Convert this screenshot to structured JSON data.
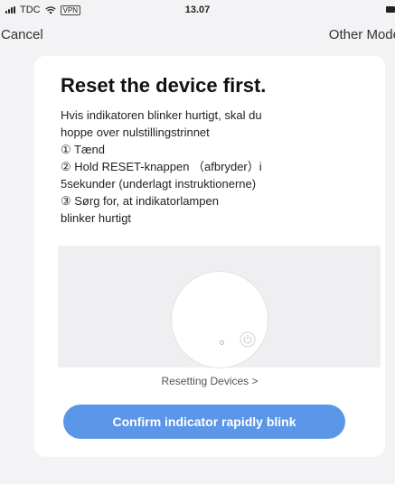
{
  "status_bar": {
    "carrier": "TDC",
    "vpn_badge": "VPN",
    "time": "13.07"
  },
  "nav": {
    "cancel_label": "Cancel",
    "other_mode_label": "Other Mode"
  },
  "card": {
    "title": "Reset the device first.",
    "instructions": [
      "Hvis indikatoren blinker hurtigt, skal du",
      "hoppe over nulstillingstrinnet",
      "① Tænd",
      "② Hold RESET-knappen （afbryder）i",
      "5sekunder (underlagt instruktionerne)",
      "③ Sørg for, at indikatorlampen",
      "blinker hurtigt"
    ],
    "resetting_link": "Resetting Devices >",
    "confirm_button": "Confirm indicator rapidly blink"
  },
  "colors": {
    "accent": "#5b96e8",
    "background": "#f3f3f5",
    "card": "#ffffff"
  },
  "icons": [
    "signal-icon",
    "wifi-icon",
    "battery-icon",
    "power-icon"
  ]
}
